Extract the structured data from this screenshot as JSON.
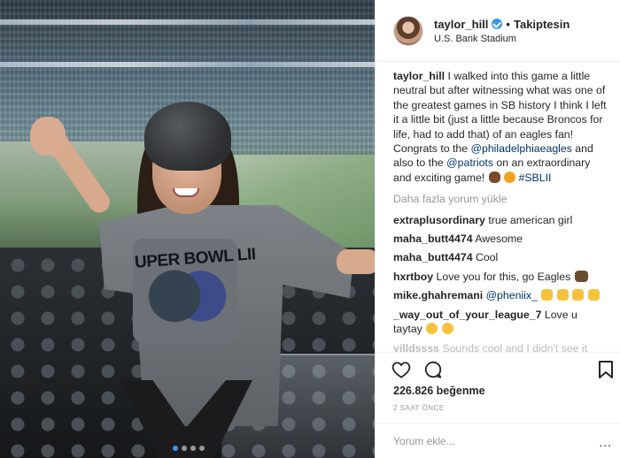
{
  "post": {
    "username": "taylor_hill",
    "follow_label": "Takiptesin",
    "location": "U.S. Bank Stadium",
    "verified": true
  },
  "caption": {
    "username": "taylor_hill",
    "text_1": "I walked into this game a little neutral but after witnessing what was one of the greatest games in SB history I think I left it a little bit (just a little because Broncos for life, had to add that) of an eagles fan! Congrats to the",
    "mention_1": "@philadelphiaeagles",
    "text_2": "and also to the",
    "mention_2": "@patriots",
    "text_3": "on an extraordinary and exciting game!",
    "hashtag": "#SBLII"
  },
  "load_more": "Daha fazla yorum yükle",
  "comments": [
    {
      "user": "extraplusordinary",
      "text": "true american girl"
    },
    {
      "user": "maha_butt4474",
      "text": "Awesome"
    },
    {
      "user": "maha_butt4474",
      "text": "Cool"
    },
    {
      "user": "hxrtboy",
      "text": "Love you for this, go Eagles"
    },
    {
      "user": "mike.ghahremani",
      "text": "@pheniix_"
    },
    {
      "user": "_way_out_of_your_league_7",
      "text": "Love u taytay"
    },
    {
      "user": "yilldssss",
      "text": "Sounds cool and I didn't see it"
    }
  ],
  "likes": "226.826 beğenme",
  "time_ago": "2 SAAT ÖNCE",
  "add_comment_placeholder": "Yorum ekle...",
  "more_options": "...",
  "photo": {
    "shirt_text": "UPER BOWL LII",
    "carousel": {
      "count": 4,
      "active_index": 0
    }
  },
  "colors": {
    "accent": "#3897f0",
    "link": "#003569",
    "text": "#262626",
    "muted": "#999999"
  },
  "icons": [
    "heart-icon",
    "comment-icon",
    "bookmark-icon",
    "verified-icon"
  ]
}
